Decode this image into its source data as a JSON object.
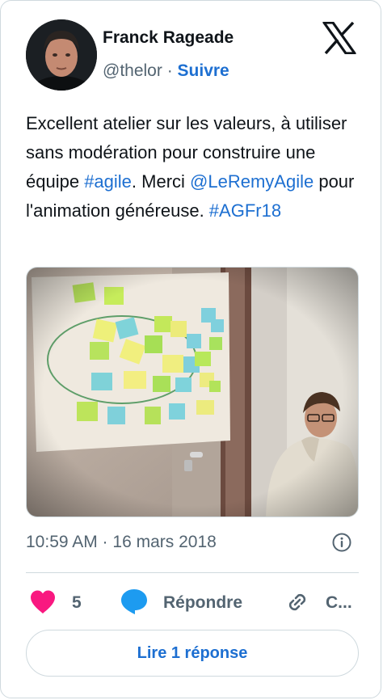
{
  "author": {
    "name": "Franck Rageade",
    "handle": "@thelor",
    "separator": " · ",
    "follow_label": "Suivre"
  },
  "tweet": {
    "segments": [
      {
        "text": "Excellent atelier sur les valeurs, à utiliser sans modération pour construire une équipe ",
        "link": false
      },
      {
        "text": "#agile",
        "link": true
      },
      {
        "text": ". Merci ",
        "link": false
      },
      {
        "text": "@LeRemyAgile",
        "link": true
      },
      {
        "text": " pour l'animation généreuse. ",
        "link": false
      },
      {
        "text": "#AGFr18",
        "link": true
      }
    ]
  },
  "meta": {
    "timestamp": "10:59 AM · 16 mars 2018"
  },
  "actions": {
    "like_count": "5",
    "reply_label": "Répondre",
    "copy_label": "C..."
  },
  "read_button": {
    "label": "Lire 1 réponse"
  },
  "colors": {
    "link": "#1d6fd1",
    "heart": "#f91880",
    "reply_icon": "#1d9bf0",
    "muted": "#536471",
    "border": "#cfd9de"
  },
  "icons": [
    "x-logo-icon",
    "info-icon",
    "heart-icon",
    "reply-bubble-icon",
    "link-icon"
  ]
}
